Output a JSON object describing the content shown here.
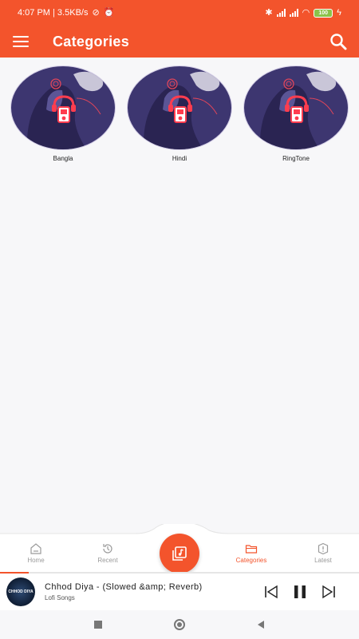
{
  "status_bar": {
    "time_and_speed": "4:07 PM | 3.5KB/s",
    "battery": "100"
  },
  "app_bar": {
    "title": "Categories",
    "menu_icon": "hamburger-menu-icon",
    "search_icon": "search-icon"
  },
  "categories": [
    {
      "label": "Bangla"
    },
    {
      "label": "Hindi"
    },
    {
      "label": "RingTone"
    }
  ],
  "bottom_nav": {
    "items": [
      {
        "label": "Home",
        "icon": "home-icon",
        "active": false
      },
      {
        "label": "Recent",
        "icon": "history-icon",
        "active": false
      },
      {
        "label": "Categories",
        "icon": "folder-icon",
        "active": true
      },
      {
        "label": "Latest",
        "icon": "alert-icon",
        "active": false
      }
    ],
    "fab_icon": "music-library-icon"
  },
  "player": {
    "title": "Chhod Diya - (Slowed &amp; Reverb)",
    "artist": "Lofi Songs",
    "album_art_text": "CHHOD DIYA",
    "progress": 0.08
  },
  "colors": {
    "primary": "#f3542c",
    "inactive": "#9a9a9a"
  }
}
